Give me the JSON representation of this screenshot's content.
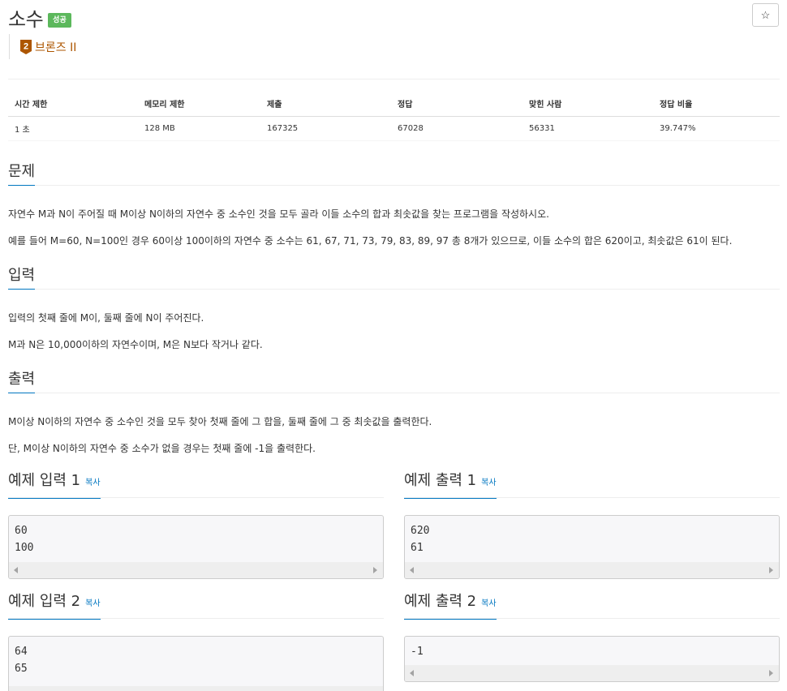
{
  "problem": {
    "title": "소수",
    "status_badge": "성공",
    "star_icon": "☆",
    "tier": {
      "level": "2",
      "label": "브론즈 II",
      "color": "#ad5600"
    }
  },
  "info_table": {
    "headers": [
      "시간 제한",
      "메모리 제한",
      "제출",
      "정답",
      "맞힌 사람",
      "정답 비율"
    ],
    "values": [
      "1 초",
      "128 MB",
      "167325",
      "67028",
      "56331",
      "39.747%"
    ]
  },
  "sections": {
    "description": {
      "title": "문제",
      "paragraphs": [
        "자연수 M과 N이 주어질 때 M이상 N이하의 자연수 중 소수인 것을 모두 골라 이들 소수의 합과 최솟값을 찾는 프로그램을 작성하시오.",
        "예를 들어 M=60, N=100인 경우 60이상 100이하의 자연수 중 소수는 61, 67, 71, 73, 79, 83, 89, 97 총 8개가 있으므로, 이들 소수의 합은 620이고, 최솟값은 61이 된다."
      ]
    },
    "input": {
      "title": "입력",
      "paragraphs": [
        "입력의 첫째 줄에 M이, 둘째 줄에 N이 주어진다.",
        "M과 N은 10,000이하의 자연수이며, M은 N보다 작거나 같다."
      ]
    },
    "output": {
      "title": "출력",
      "paragraphs": [
        "M이상 N이하의 자연수 중 소수인 것을 모두 찾아 첫째 줄에 그 합을, 둘째 줄에 그 중 최솟값을 출력한다.",
        "단, M이상 N이하의 자연수 중 소수가 없을 경우는 첫째 줄에 -1을 출력한다."
      ]
    }
  },
  "samples": {
    "copy_label": "복사",
    "input1": {
      "title": "예제 입력 1",
      "content": "60\n100"
    },
    "output1": {
      "title": "예제 출력 1",
      "content": "620\n61"
    },
    "input2": {
      "title": "예제 입력 2",
      "content": "64\n65"
    },
    "output2": {
      "title": "예제 출력 2",
      "content": "-1"
    }
  },
  "colors": {
    "accent": "#0076c0",
    "success": "#5cb85c",
    "bronze": "#ad5600"
  }
}
